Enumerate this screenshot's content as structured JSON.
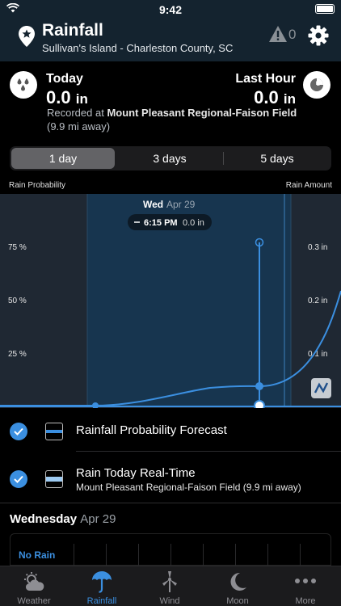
{
  "status_bar": {
    "time": "9:42"
  },
  "header": {
    "title": "Rainfall",
    "location": "Sullivan's Island - Charleston County, SC",
    "alert_count": "0"
  },
  "today": {
    "label": "Today",
    "value": "0.0",
    "unit": "in",
    "recorded_prefix": "Recorded at",
    "station": "Mount Pleasant Regional-Faison Field",
    "distance": "(9.9 mi away)"
  },
  "last_hour": {
    "label": "Last Hour",
    "value": "0.0",
    "unit": "in"
  },
  "range_tabs": [
    {
      "label": "1 day",
      "selected": true
    },
    {
      "label": "3 days",
      "selected": false
    },
    {
      "label": "5 days",
      "selected": false
    }
  ],
  "chart": {
    "left_axis_title": "Rain Probability",
    "right_axis_title": "Rain Amount",
    "day_label": "Wed",
    "day_date": "Apr 29",
    "tooltip_time": "6:15 PM",
    "tooltip_value": "0.0 in",
    "left_ticks": [
      "75 %",
      "50 %",
      "25 %"
    ],
    "right_ticks": [
      "0.3 in",
      "0.2 in",
      "0.1 in"
    ]
  },
  "legend": [
    {
      "label": "Rainfall Probability Forecast",
      "sublabel": "",
      "checked": true
    },
    {
      "label": "Rain Today Real-Time",
      "sublabel": "Mount Pleasant Regional-Faison Field (9.9 mi away)",
      "checked": true
    }
  ],
  "day_section": {
    "weekday": "Wednesday",
    "date": "Apr 29",
    "status": "No Rain"
  },
  "tab_bar": [
    {
      "label": "Weather",
      "icon": "weather-icon",
      "active": false
    },
    {
      "label": "Rainfall",
      "icon": "umbrella-icon",
      "active": true
    },
    {
      "label": "Wind",
      "icon": "wind-turbine-icon",
      "active": false
    },
    {
      "label": "Moon",
      "icon": "moon-icon",
      "active": false
    },
    {
      "label": "More",
      "icon": "more-icon",
      "active": false
    }
  ],
  "colors": {
    "accent": "#3b8fe0",
    "header_bg": "#14232f",
    "chart_bg": "#1f2833",
    "selected_band": "#17354f"
  }
}
